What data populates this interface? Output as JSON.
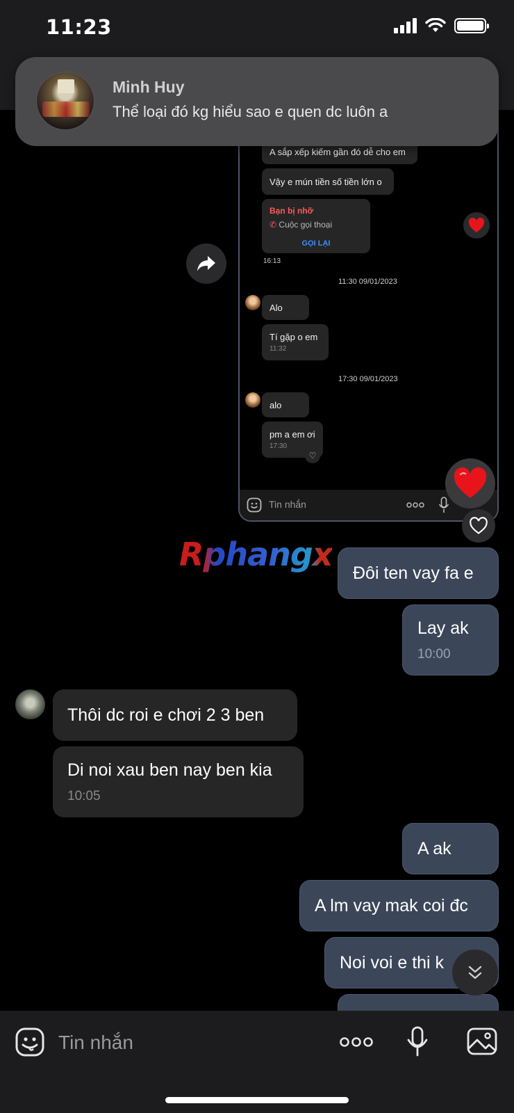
{
  "status_bar": {
    "time": "11:23"
  },
  "notification": {
    "sender": "Minh Huy",
    "message": "Thể loại đó kg hiểu sao e quen dc luôn a"
  },
  "embedded_screenshot": {
    "messages": [
      {
        "text": "A sắp xếp kiếm gần đó dễ cho em"
      },
      {
        "text": "Vậy e mún tiền số tiền lớn o"
      },
      {
        "missed_call_title": "Bạn bị nhỡ",
        "missed_call_sub": "Cuộc gọi thoại",
        "call_back": "GỌI LẠI",
        "time": "16:13"
      },
      {
        "stamp": "11:30 09/01/2023"
      },
      {
        "text": "Alo"
      },
      {
        "text": "Tí gặp o em",
        "time": "11:32"
      },
      {
        "stamp": "17:30 09/01/2023"
      },
      {
        "text": "alo"
      },
      {
        "text": "pm a em ơi",
        "time": "17:30"
      }
    ],
    "input_placeholder": "Tin nhắn"
  },
  "watermark": "Rphangx",
  "chat": {
    "messages": [
      {
        "dir": "out",
        "text": "Đôi ten vay fa e"
      },
      {
        "dir": "out",
        "text": "Lay ak",
        "time": "10:00"
      },
      {
        "dir": "in",
        "text": "Thôi dc roi e chơi 2 3 ben"
      },
      {
        "dir": "in",
        "text": "Di noi xau ben nay ben kia",
        "time": "10:05"
      },
      {
        "dir": "out",
        "text": "A ak"
      },
      {
        "dir": "out",
        "text": "A lm vay mak coi đc"
      },
      {
        "dir": "out",
        "text": "Noi voi e thi k"
      }
    ]
  },
  "bottom_bar": {
    "input_placeholder": "Tin nhắn"
  },
  "colors": {
    "outgoing_bubble": "#3b4659",
    "incoming_bubble": "#262626",
    "background": "#000000",
    "reaction_heart": "#e8141c"
  }
}
